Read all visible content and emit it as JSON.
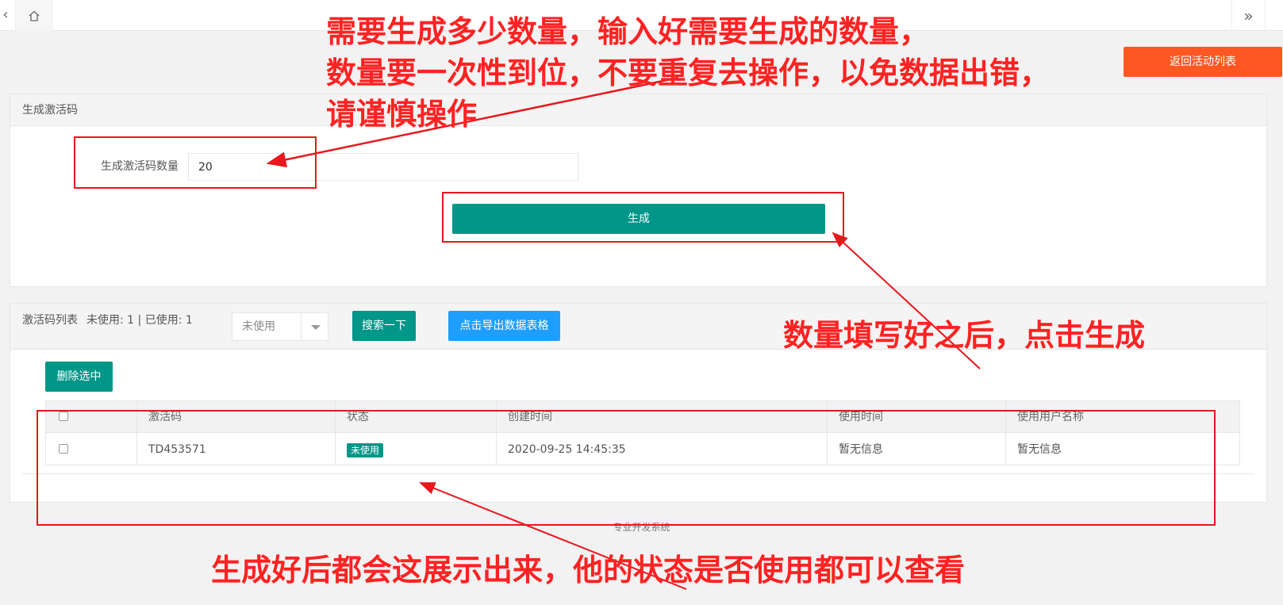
{
  "nav": {
    "back_label": "返回活动列表"
  },
  "generate_card": {
    "title": "生成激活码",
    "count_label": "生成激活码数量",
    "count_value": "20",
    "generate_label": "生成"
  },
  "list_card": {
    "title": "激活码列表",
    "counts": "未使用: 1 | 已使用: 1",
    "status_filter": "未使用",
    "search_label": "搜索一下",
    "export_label": "点击导出数据表格",
    "delete_label": "删除选中",
    "columns": [
      "激活码",
      "状态",
      "创建时间",
      "使用时间",
      "使用用户名称"
    ],
    "rows": [
      {
        "code": "TD453571",
        "status": "未使用",
        "created": "2020-09-25 14:45:35",
        "used_time": "暂无信息",
        "user": "暂无信息"
      }
    ]
  },
  "footer": "专业开发系统",
  "annotations": {
    "top_lines": [
      "需要生成多少数量，输入好需要生成的数量，",
      "数量要一次性到位，不要重复去操作，以免数据出错，",
      "请谨慎操作"
    ],
    "right": "数量填写好之后，点击生成",
    "bottom": "生成好后都会这展示出来，他的状态是否使用都可以查看"
  },
  "colors": {
    "primary": "#009688",
    "accent": "#ff5722",
    "info": "#1e9fff",
    "annotation": "#ff2222"
  }
}
